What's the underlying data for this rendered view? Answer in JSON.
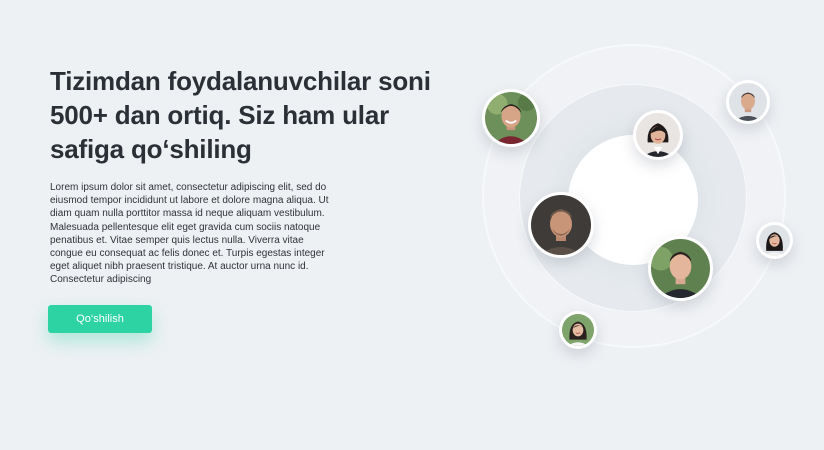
{
  "hero": {
    "headline": "Tizimdan foydalanuvchilar soni 500+ dan ortiq. Siz ham ular safiga qo‘shiling",
    "body": "Lorem ipsum dolor sit amet, consectetur adipiscing elit, sed do eiusmod tempor incididunt ut labore et dolore magna aliqua. Ut diam quam nulla porttitor massa id neque aliquam vestibulum. Malesuada pellentesque elit eget gravida cum sociis natoque penatibus et. Vitae semper quis lectus nulla. Viverra vitae congue eu consequat ac felis donec et. Turpis egestas integer eget aliquet nibh praesent tristique. At auctor urna nunc id. Consectetur adipiscing",
    "cta_label": "Qo‘shilish"
  },
  "colors": {
    "background": "#eef1f4",
    "accent": "#2ed3a4",
    "heading": "#2b2f36"
  },
  "avatars": [
    {
      "icon": "user-photo",
      "person": "smiling man, green foliage background"
    },
    {
      "icon": "user-photo",
      "person": "man with short dark hair, light background"
    },
    {
      "icon": "user-photo",
      "person": "woman with dark hair, dark blazer"
    },
    {
      "icon": "user-photo",
      "person": "man with short hair, dark background"
    },
    {
      "icon": "user-photo",
      "person": "woman with long dark hair"
    },
    {
      "icon": "user-photo",
      "person": "young man in dark shirt, green background"
    },
    {
      "icon": "user-photo",
      "person": "woman in white top, green background"
    }
  ]
}
